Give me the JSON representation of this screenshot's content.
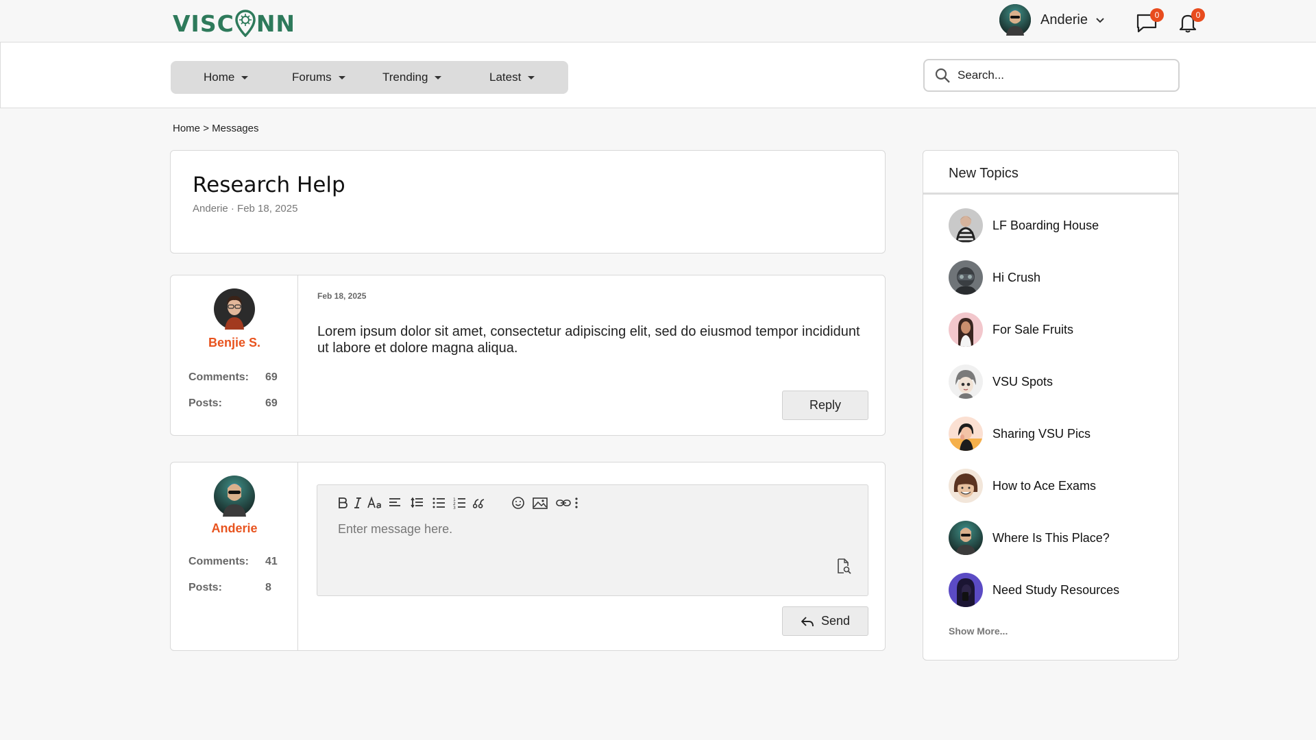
{
  "header": {
    "logo_text_left": "VISC",
    "logo_text_right": "NN",
    "user_name": "Anderie",
    "messages_count": "0",
    "notifications_count": "0"
  },
  "nav": {
    "tabs": [
      {
        "label": "Home"
      },
      {
        "label": "Forums"
      },
      {
        "label": "Trending"
      },
      {
        "label": "Latest"
      }
    ],
    "search_placeholder": "Search..."
  },
  "breadcrumb": {
    "home": "Home",
    "separator": ">",
    "current": "Messages"
  },
  "thread": {
    "title": "Research Help",
    "meta": "Anderie · Feb 18, 2025"
  },
  "post": {
    "author": "Benjie S.",
    "comments_label": "Comments:",
    "comments": "69",
    "posts_label": "Posts:",
    "posts": "69",
    "date": "Feb 18, 2025",
    "body": "Lorem ipsum dolor sit amet, consectetur adipiscing elit, sed do eiusmod tempor incididunt ut labore et dolore magna aliqua.",
    "reply_label": "Reply"
  },
  "composer": {
    "author": "Anderie",
    "comments_label": "Comments:",
    "comments": "41",
    "posts_label": "Posts:",
    "posts": "8",
    "placeholder": "Enter message here.",
    "send_label": "Send",
    "toolbar_icons": [
      "bold-icon",
      "italic-icon",
      "font-size-icon",
      "align-icon",
      "line-height-icon",
      "bullet-list-icon",
      "numbered-list-icon",
      "quote-icon",
      "emoji-icon",
      "image-icon",
      "link-icon",
      "more-icon"
    ]
  },
  "sidebar": {
    "title": "New Topics",
    "topics": [
      {
        "label": "LF Boarding House"
      },
      {
        "label": "Hi Crush"
      },
      {
        "label": "For Sale Fruits"
      },
      {
        "label": "VSU Spots"
      },
      {
        "label": "Sharing VSU Pics"
      },
      {
        "label": "How to Ace Exams"
      },
      {
        "label": "Where Is This Place?"
      },
      {
        "label": "Need Study Resources"
      }
    ],
    "show_more": "Show More..."
  },
  "colors": {
    "brand": "#2e7a5b",
    "accent": "#e8531e",
    "badge": "#e84c1e"
  }
}
